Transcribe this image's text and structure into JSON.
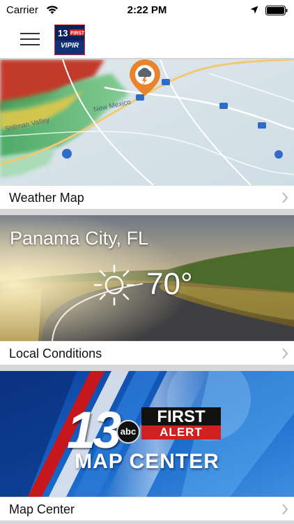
{
  "status_bar": {
    "carrier": "Carrier",
    "time": "2:22 PM"
  },
  "nav": {
    "logo_text_top": "13",
    "logo_text_badge": "FIRST",
    "logo_text_bottom": "VIPIR"
  },
  "cards": {
    "weather_map": {
      "label": "Weather Map"
    },
    "local_conditions": {
      "label": "Local Conditions",
      "city": "Panama City, FL",
      "temperature": "70°",
      "icon": "sun-icon"
    },
    "map_center": {
      "label": "Map Center",
      "logo_number": "13",
      "logo_network": "abc",
      "logo_first": "FIRST",
      "logo_alert": "ALERT",
      "title": "MAP CENTER"
    }
  },
  "colors": {
    "brand_navy": "#0b1f5a",
    "alert_red": "#d12020",
    "map_blue": "#1565c8"
  }
}
